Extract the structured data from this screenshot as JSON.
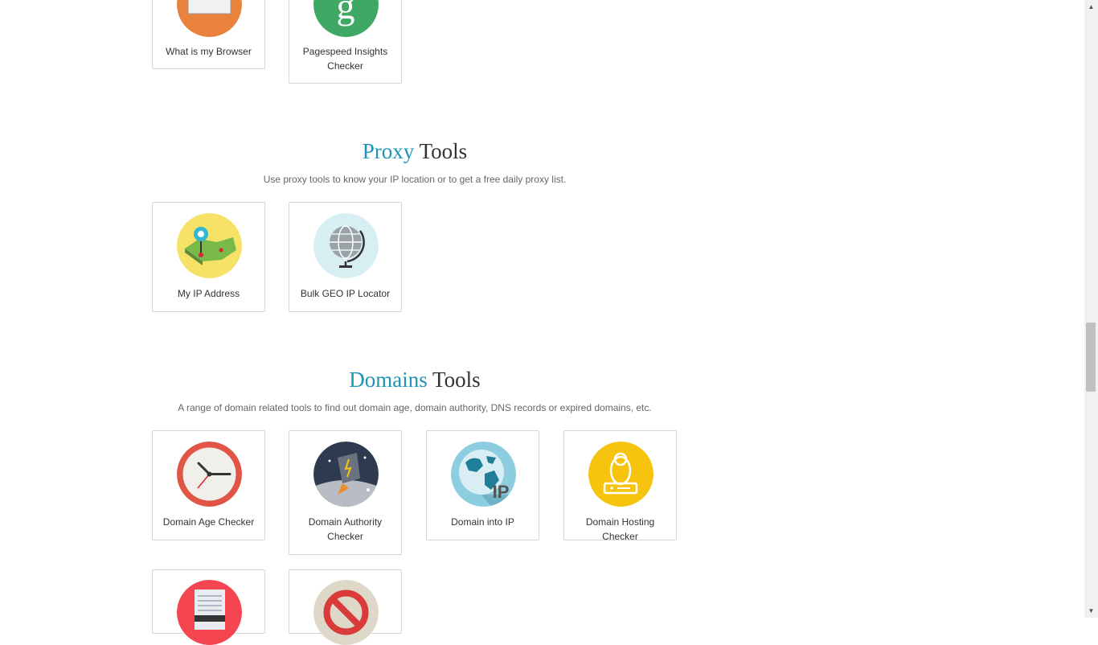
{
  "sections": {
    "top": {
      "cards": [
        {
          "label": "What is my Browser"
        },
        {
          "label": "Pagespeed Insights Checker"
        }
      ]
    },
    "proxy": {
      "title_accent": "Proxy",
      "title_rest": " Tools",
      "description": "Use proxy tools to know your IP location or to get a free daily proxy list.",
      "cards": [
        {
          "label": "My IP Address"
        },
        {
          "label": "Bulk GEO IP Locator"
        }
      ]
    },
    "domains": {
      "title_accent": "Domains",
      "title_rest": " Tools",
      "description": "A range of domain related tools to find out domain age, domain authority, DNS records or expired domains, etc.",
      "cards": [
        {
          "label": "Domain Age Checker"
        },
        {
          "label": "Domain Authority Checker"
        },
        {
          "label": "Domain into IP"
        },
        {
          "label": "Domain Hosting Checker"
        }
      ]
    }
  },
  "icons": {
    "browser": "browser-icon",
    "pagespeed": "google-plus-icon",
    "my_ip": "map-pin-icon",
    "geo_ip": "globe-icon",
    "domain_age": "clock-icon",
    "domain_authority": "rocket-icon",
    "domain_ip": "world-ip-icon",
    "hosting": "linux-penguin-icon",
    "server": "server-icon",
    "blocked": "blocked-icon"
  },
  "domain_ip_badge": "IP",
  "colors": {
    "accent": "#1f93b6",
    "orange": "#e8823d",
    "green": "#3fa865",
    "yellow": "#f5e266",
    "light_blue": "#d7eef3",
    "red": "#e05545",
    "navy": "#2e3b4e",
    "sky": "#8ccde0",
    "gold": "#f6c40f",
    "bright_red": "#f54550",
    "beige": "#ddd8c8"
  },
  "scrollbar": {
    "up_arrow": "▲",
    "down_arrow": "▼"
  }
}
